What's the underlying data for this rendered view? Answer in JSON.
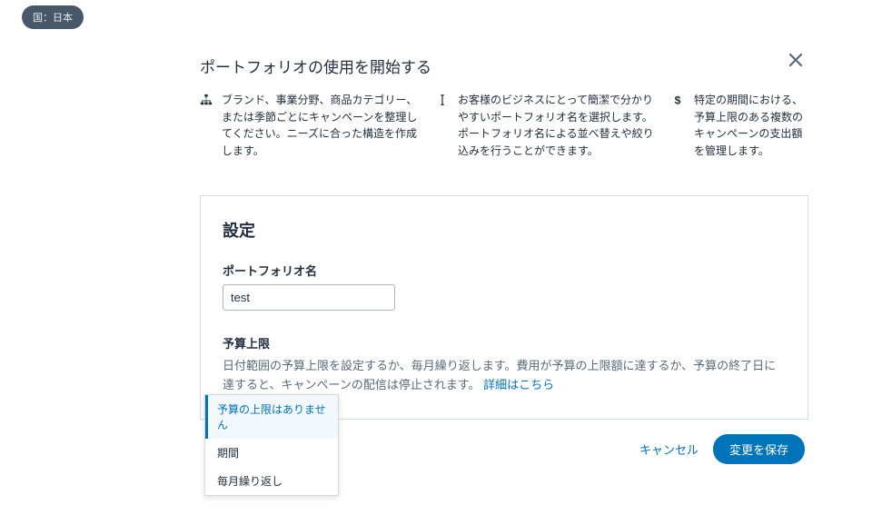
{
  "country_pill": "国：日本",
  "header": {
    "title": "ポートフォリオの使用を開始する",
    "tips": [
      "ブランド、事業分野、商品カテゴリー、または季節ごとにキャンペーンを整理してください。ニーズに合った構造を作成します。",
      "お客様のビジネスにとって簡潔で分かりやすいポートフォリオ名を選択します。ポートフォリオ名による並べ替えや絞り込みを行うことができます。",
      "特定の期間における、予算上限のある複数のキャンペーンの支出額を管理します。"
    ]
  },
  "settings": {
    "heading": "設定",
    "name_label": "ポートフォリオ名",
    "name_value": "test",
    "budget_label": "予算上限",
    "budget_descr_1": "日付範囲の予算上限を設定するか、毎月繰り返します。費用が予算の上限額に達するか、予算の終了日に達すると、キャンペーンの配信は停止されます。",
    "budget_link": "詳細はこちら",
    "dropdown": {
      "items": [
        "予算の上限はありません",
        "期間",
        "毎月繰り返し"
      ],
      "selected_index": 0
    }
  },
  "actions": {
    "cancel": "キャンセル",
    "save": "変更を保存"
  }
}
